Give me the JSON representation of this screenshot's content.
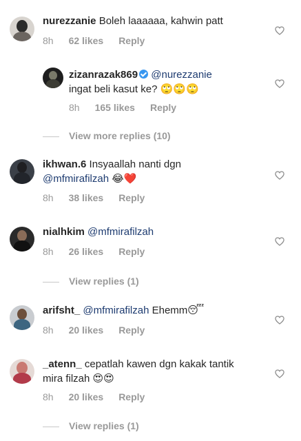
{
  "comments": [
    {
      "username": "nurezzanie",
      "text": "Boleh laaaaaa, kahwin patt",
      "time": "8h",
      "likes": "62 likes",
      "reply": "Reply"
    },
    {
      "username": "zizanrazak869",
      "verified": true,
      "mention": "@nurezzanie",
      "text": "ingat beli kasut ke?",
      "emoji": "🙄🙄🙄",
      "time": "8h",
      "likes": "165 likes",
      "reply": "Reply"
    },
    {
      "username": "ikhwan.6",
      "text": "Insyaallah nanti dgn",
      "mention": "@mfmirafilzah",
      "emoji": "😂❤️",
      "time": "8h",
      "likes": "38 likes",
      "reply": "Reply"
    },
    {
      "username": "nialhkim",
      "mention": "@mfmirafilzah",
      "time": "8h",
      "likes": "26 likes",
      "reply": "Reply"
    },
    {
      "username": "arifsht_",
      "mention": "@mfmirafilzah",
      "text": "Ehemm",
      "emoji": "😴",
      "time": "8h",
      "likes": "20 likes",
      "reply": "Reply"
    },
    {
      "username": "_atenn_",
      "text": "cepatlah kawen dgn kakak tantik",
      "text2": "mira filzah",
      "emoji": "😍😍",
      "time": "8h",
      "likes": "20 likes",
      "reply": "Reply"
    }
  ],
  "view_more_replies": "View more replies (10)",
  "view_replies_1": "View replies (1)",
  "view_replies_2": "View replies (1)",
  "icons": {
    "heart": "heart-outline-icon",
    "verified": "verified-badge-icon"
  },
  "colors": {
    "mention": "#1d3b70",
    "meta": "#999999",
    "verified": "#3897f0"
  }
}
